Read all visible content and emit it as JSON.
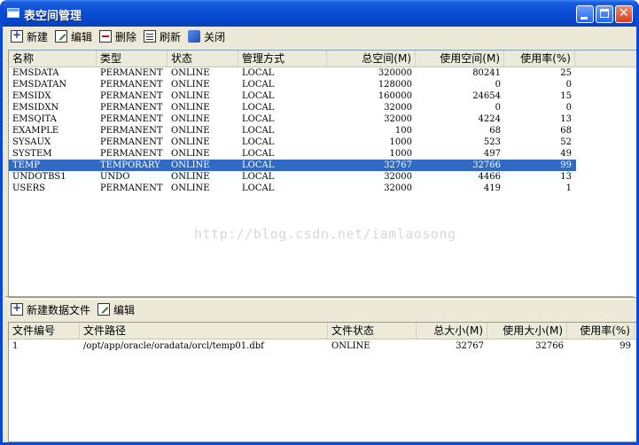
{
  "window": {
    "title": "表空间管理"
  },
  "toolbar_top": {
    "new": "新建",
    "edit": "编辑",
    "delete": "删除",
    "refresh": "刷新",
    "close": "关闭"
  },
  "tablespace_table": {
    "headers": [
      "名称",
      "类型",
      "状态",
      "管理方式",
      "总空间(M)",
      "使用空间(M)",
      "使用率(%)"
    ],
    "rows": [
      [
        "EMSDATA",
        "PERMANENT",
        "ONLINE",
        "LOCAL",
        "320000",
        "80241",
        "25"
      ],
      [
        "EMSDATAN",
        "PERMANENT",
        "ONLINE",
        "LOCAL",
        "128000",
        "0",
        "0"
      ],
      [
        "EMSIDX",
        "PERMANENT",
        "ONLINE",
        "LOCAL",
        "160000",
        "24654",
        "15"
      ],
      [
        "EMSIDXN",
        "PERMANENT",
        "ONLINE",
        "LOCAL",
        "32000",
        "0",
        "0"
      ],
      [
        "EMSQITA",
        "PERMANENT",
        "ONLINE",
        "LOCAL",
        "32000",
        "4224",
        "13"
      ],
      [
        "EXAMPLE",
        "PERMANENT",
        "ONLINE",
        "LOCAL",
        "100",
        "68",
        "68"
      ],
      [
        "SYSAUX",
        "PERMANENT",
        "ONLINE",
        "LOCAL",
        "1000",
        "523",
        "52"
      ],
      [
        "SYSTEM",
        "PERMANENT",
        "ONLINE",
        "LOCAL",
        "1000",
        "497",
        "49"
      ],
      [
        "TEMP",
        "TEMPORARY",
        "ONLINE",
        "LOCAL",
        "32767",
        "32766",
        "99"
      ],
      [
        "UNDOTBS1",
        "UNDO",
        "ONLINE",
        "LOCAL",
        "32000",
        "4466",
        "13"
      ],
      [
        "USERS",
        "PERMANENT",
        "ONLINE",
        "LOCAL",
        "32000",
        "419",
        "1"
      ]
    ],
    "selected_row": 8
  },
  "watermark": "http://blog.csdn.net/iamlaosong",
  "toolbar_bottom": {
    "new_datafile": "新建数据文件",
    "edit": "编辑"
  },
  "datafile_table": {
    "headers": [
      "文件编号",
      "文件路径",
      "文件状态",
      "总大小(M)",
      "使用大小(M)",
      "使用率(%)"
    ],
    "rows": [
      [
        "1",
        "/opt/app/oracle/oradata/orcl/temp01.dbf",
        "ONLINE",
        "32767",
        "32766",
        "99"
      ]
    ]
  }
}
